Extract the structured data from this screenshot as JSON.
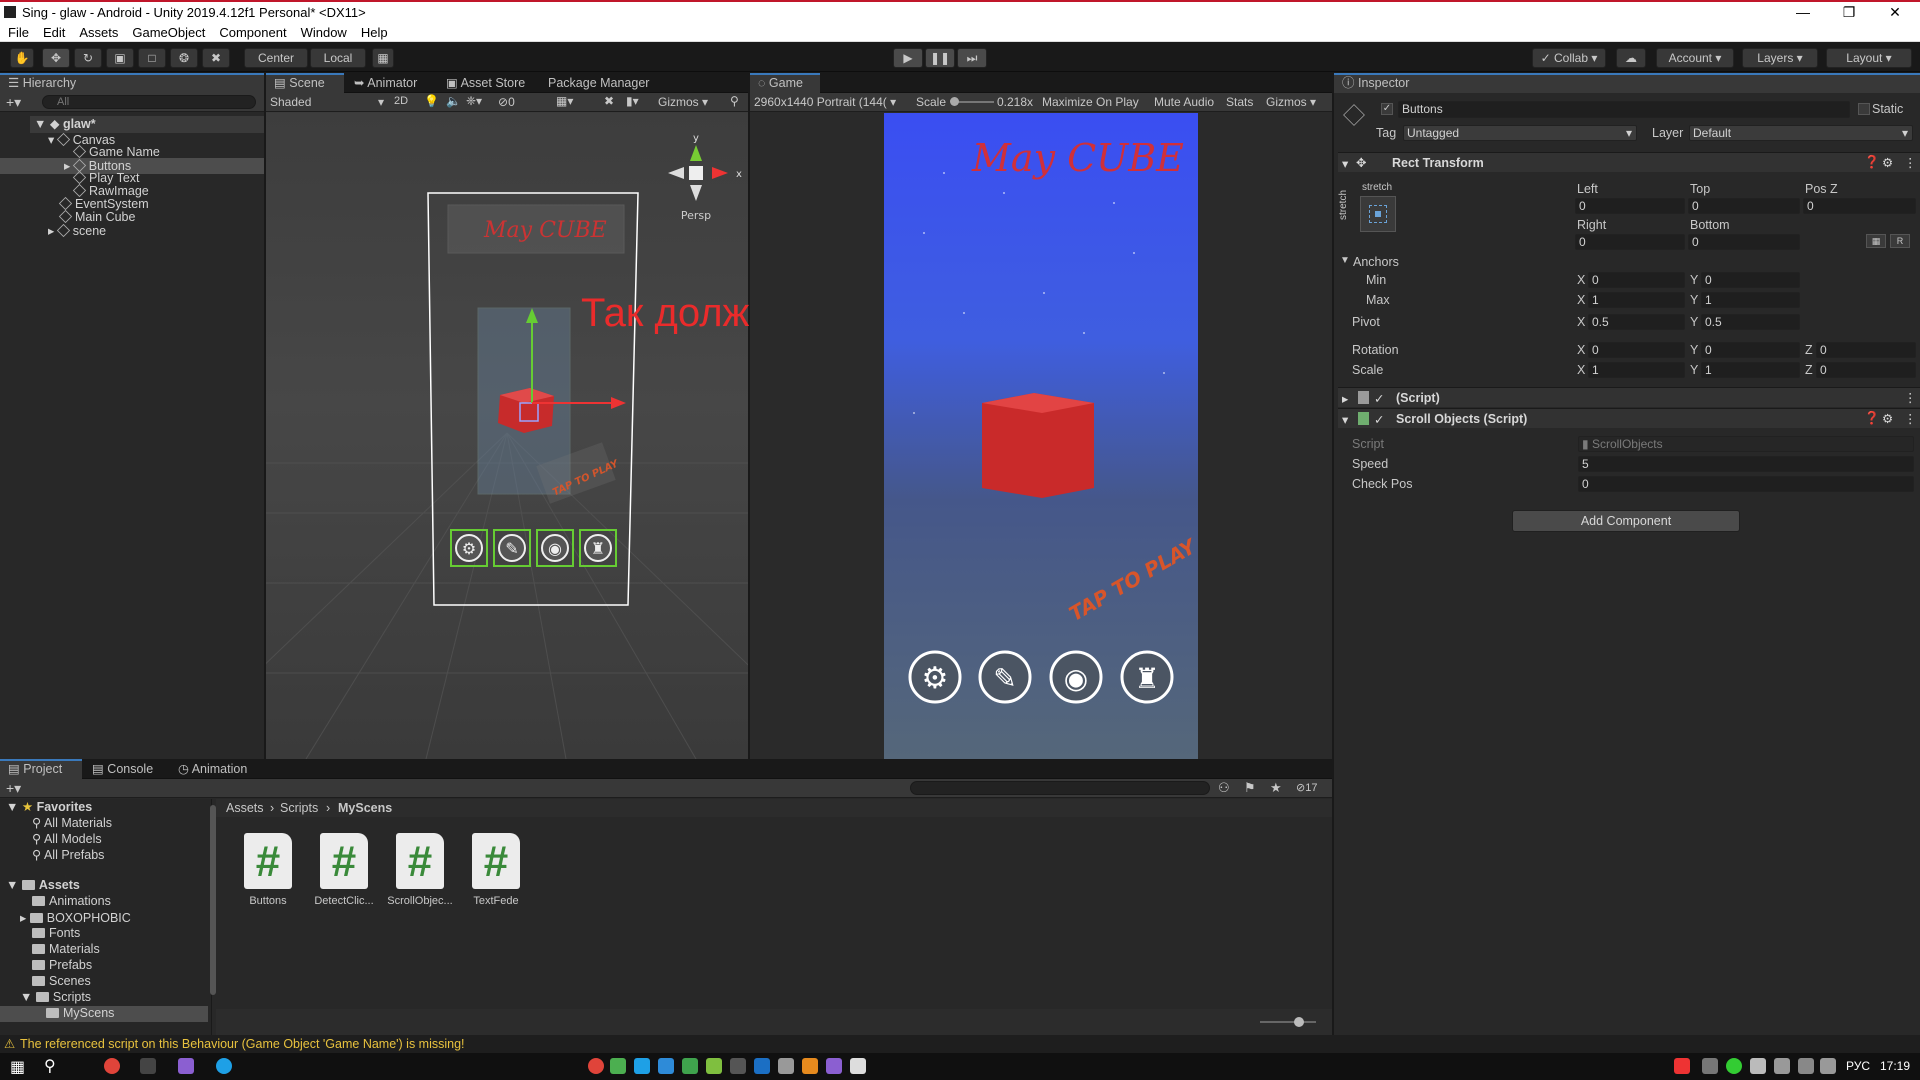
{
  "window": {
    "title": "Sing - glaw - Android - Unity 2019.4.12f1 Personal* <DX11>"
  },
  "menu": [
    "File",
    "Edit",
    "Assets",
    "GameObject",
    "Component",
    "Window",
    "Help"
  ],
  "toolbar": {
    "center": "Center",
    "local": "Local",
    "collab": "Collab",
    "account": "Account",
    "layers": "Layers",
    "layout": "Layout"
  },
  "hierarchy": {
    "tab": "Hierarchy",
    "search_placeholder": "All",
    "scene": "glaw*",
    "items": [
      {
        "label": "Canvas",
        "indent": 1
      },
      {
        "label": "Game Name",
        "indent": 2
      },
      {
        "label": "Buttons",
        "indent": 2
      },
      {
        "label": "Play Text",
        "indent": 2
      },
      {
        "label": "RawImage",
        "indent": 2
      },
      {
        "label": "EventSystem",
        "indent": 1
      },
      {
        "label": "Main Cube",
        "indent": 1
      },
      {
        "label": "scene",
        "indent": 1
      }
    ]
  },
  "scene_view": {
    "tabs": [
      "Scene",
      "Animator",
      "Asset Store",
      "Package Manager"
    ],
    "shading": "Shaded",
    "mode_2d": "2D",
    "gizmos": "Gizmos",
    "hidden_count": "0",
    "persp": "Persp",
    "overlay_text": "Так должно быть!",
    "title_art": "May CUBE",
    "tap_art": "TAP TO PLAY"
  },
  "game_view": {
    "tab": "Game",
    "resolution": "2960x1440 Portrait (144(",
    "scale_label": "Scale",
    "scale_value": "0.218x",
    "maximize": "Maximize On Play",
    "mute": "Mute Audio",
    "stats": "Stats",
    "gizmos": "Gizmos",
    "title_art": "May CUBE",
    "tap_art": "TAP TO PLAY"
  },
  "inspector": {
    "tab": "Inspector",
    "object_name": "Buttons",
    "static": "Static",
    "tag_label": "Tag",
    "tag_value": "Untagged",
    "layer_label": "Layer",
    "layer_value": "Default",
    "rect_transform": "Rect Transform",
    "stretch": "stretch",
    "left_label": "Left",
    "left": "0",
    "top_label": "Top",
    "top": "0",
    "posz_label": "Pos Z",
    "posz": "0",
    "right_label": "Right",
    "right": "0",
    "bottom_label": "Bottom",
    "bottom": "0",
    "anchors": "Anchors",
    "min_label": "Min",
    "min_x": "0",
    "min_y": "0",
    "max_label": "Max",
    "max_x": "1",
    "max_y": "1",
    "pivot_label": "Pivot",
    "pivot_x": "0.5",
    "pivot_y": "0.5",
    "rotation_label": "Rotation",
    "rot_x": "0",
    "rot_y": "0",
    "rot_z": "0",
    "scale_label": "Scale",
    "scale_x": "1",
    "scale_y": "1",
    "scale_z": "0",
    "missing_script": "(Script)",
    "scroll_objects": "Scroll Objects (Script)",
    "script_label": "Script",
    "script_value": "ScrollObjects",
    "speed_label": "Speed",
    "speed": "5",
    "checkpos_label": "Check Pos",
    "checkpos": "0",
    "add_component": "Add Component",
    "axis_x": "X",
    "axis_y": "Y",
    "axis_z": "Z"
  },
  "project": {
    "tabs": [
      "Project",
      "Console",
      "Animation"
    ],
    "favorites": "Favorites",
    "fav_items": [
      "All Materials",
      "All Models",
      "All Prefabs"
    ],
    "assets": "Assets",
    "folders": [
      "Animations",
      "BOXOPHOBIC",
      "Fonts",
      "Materials",
      "Prefabs",
      "Scenes",
      "Scripts"
    ],
    "subfolder": "MyScens",
    "breadcrumb": [
      "Assets",
      "Scripts",
      "MyScens"
    ],
    "files": [
      "Buttons",
      "DetectClic...",
      "ScrollObjec...",
      "TextFede"
    ],
    "hidden_count": "17"
  },
  "status": {
    "message": "The referenced script on this Behaviour (Game Object 'Game Name') is missing!"
  },
  "taskbar": {
    "lang": "РУС",
    "time": "17:19"
  }
}
